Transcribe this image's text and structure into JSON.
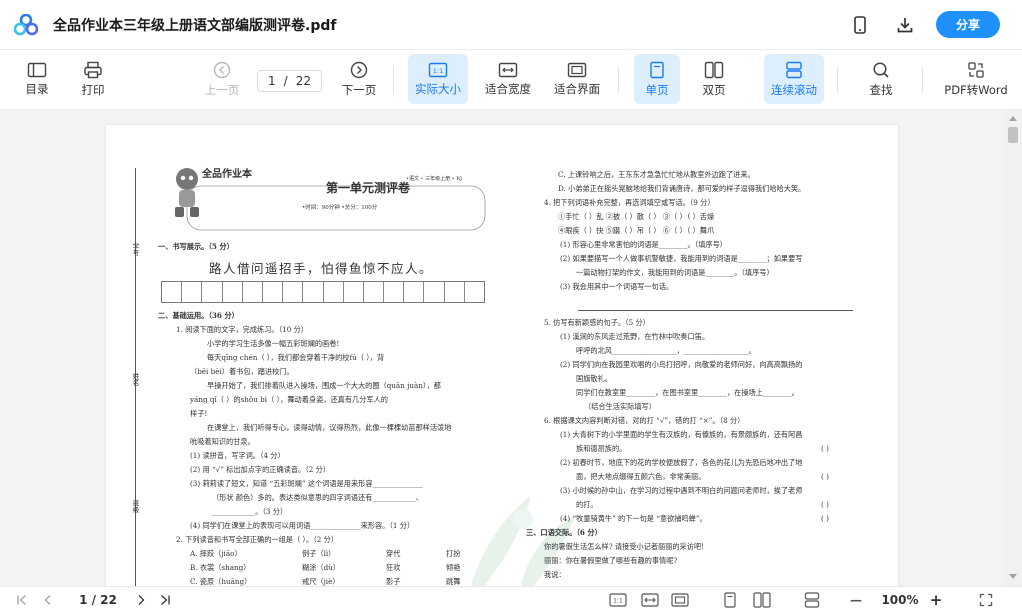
{
  "app": {
    "title": "全品作业本三年级上册语文部编版测评卷.pdf",
    "share_label": "分享"
  },
  "toolbar": {
    "catalog": "目录",
    "print": "打印",
    "prev_page": "上一页",
    "current_page": "1",
    "page_separator": "/",
    "total_pages": "22",
    "next_page": "下一页",
    "actual_size": "实际大小",
    "fit_width": "适合宽度",
    "fit_page": "适合界面",
    "single_page": "单页",
    "double_page": "双页",
    "continuous_scroll": "连续滚动",
    "find": "查找",
    "pdf_to_word": "PDF转Word",
    "actual_size_icon_text": "1:1"
  },
  "statusbar": {
    "page_label": "1 / 22",
    "zoom": "100%",
    "minus": "—",
    "plus": "+",
    "ratio_icon_text": "1:1"
  },
  "pdf": {
    "brand": "全品作业本",
    "header_right": "•语文 • 三年级上册 • RJ",
    "unit_title": "第一单元测评卷",
    "meta": "•时间：90分钟        •总分：100分",
    "side_labels": [
      "学号",
      "姓名",
      "班级",
      "学校"
    ],
    "left_lines": [
      "一、书写展示。（5 分）",
      "二、基础运用。（36 分）",
      "1. 阅读下面的文字，完成练习。（10 分）",
      "小学的学习生活多像一幅五彩斑斓的画卷!",
      "每天qīng chén（        ），我们都会穿着干净的校fú（        ），背",
      "（bēi  bèi）着书包，踏进校门。",
      "早操开始了，我们排着队进入操场，围成一个大大的圈（quān  juàn），都",
      "yáng qǐ（            ）的shǒu bì（            ），舞动着身姿，还真有几分军人的",
      "样子!",
      "在课堂上，我们听得专心，读得动情，议得热烈，此像一棵棵幼苗那样活泼地",
      "吮吸着知识的甘泉。",
      "(1) 读拼音，写字词。（4 分）",
      "(2) 用 “√” 标出加点字的正确读音。（2 分）",
      "(3) 莉莉读了短文，知道 “五彩斑斓” 这个词语是用来形容______________",
      "（形状   颜色）多的。表达类似意思的四字词语还有____________、",
      "____________。（3 分）",
      "(4) 同学们在课堂上的表现可以用词语______________来形容。（1 分）",
      "2. 下列读音和书写全部正确的一组是（    ）。（2 分）",
      "A. 摔跤（jiāo）",
      "例子（lì）",
      "穿代",
      "打扮",
      "B. 衣裳（shang）",
      "糊涂（dù）",
      "狂欢",
      "倾艳",
      "C. 瓷原（huāng）",
      "戒尺（jiè）",
      "影子",
      "跳舞"
    ],
    "big_sentence": "路人借问遥招手，怕得鱼惊不应人。",
    "right_lines": [
      "C. 上课铃响之后，王东东才急急忙忙地从教室外边跑了进来。",
      "D. 小弟弟正在摇头晃脑地给我们背诵唐诗，那可爱的样子逗得我们哈哈大笑。",
      "4. 把下列词语补充完整，再选词填空或写话。（9 分）",
      "①手忙（    ）乱    ②披（    ）散（    ）    ③（    ）（    ）舌燥",
      "④眼疾（    ）快    ⑤蹑（    ）吊（    ）    ⑥（    ）（    ）舞爪",
      "(1) 形容心里非常害怕的词语是________。（填序号）",
      "(2) 如果要描写一个人做事机警敏捷，我能用到的词语是________；如果要写",
      "一篇动物打架的作文，我能用到的词语是________。（填序号）",
      "(3) 我会用其中一个词语写一句话。",
      "5. 仿写有新颖感的句子。（5 分）",
      "(1) 溪涧的东风走过荒野，在竹林中吹奏口笛。",
      "呼呼的北风__________________，__________________。",
      "(2) 同学们向在我园里欢唱的小鸟打招呼，向敬爱的老师问好，向高高飘扬的",
      "国旗敬礼。",
      "同学们在教室里________，在图书室里________，在操场上________。",
      "（结合生活实际填写）",
      "6. 根据课文内容判断对错，对的打 “√”，错的打 “×”。（8 分）",
      "(1) 大青树下的小学里面的学生有汉族的，有傣族的，有景颇族的，还有阿昌",
      "族和德昂族的。",
      "(2) 初春时节，地底下的花的学校便放假了，各色的花儿为先恐后地冲出了地",
      "面，把大地点缀得五颜六色，非常美丽。",
      "(3) 小时候的孙中山，在学习的过程中遇到不明白的问题问老师时，挨了老师",
      "的打。",
      "(4) “牧童骑黄牛” 的下一句是 “意欲捕鸣蝉”。",
      "三、口语交际。（6 分）",
      "你的暑假生活怎么样? 请接受小记者丽丽的采访吧!",
      "丽丽：你在暑假里做了哪些有趣的事情呢?",
      "我说："
    ],
    "answer_parens": "(        )"
  }
}
